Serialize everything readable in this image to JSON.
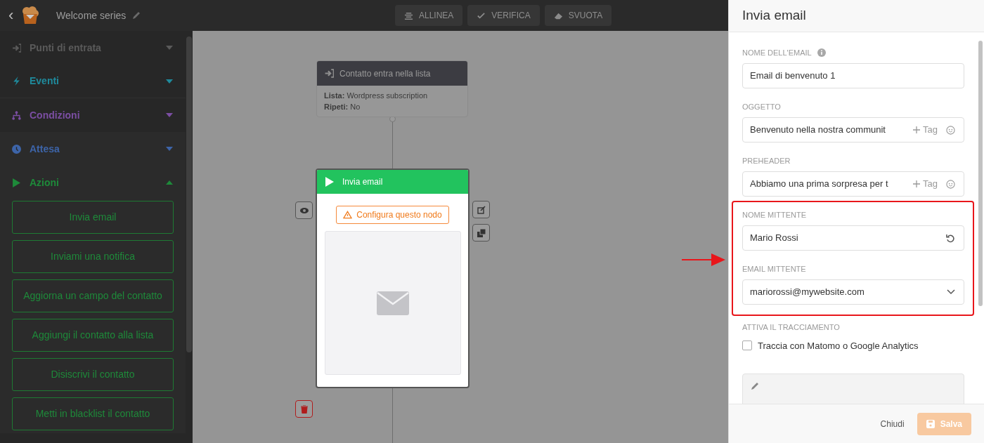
{
  "header": {
    "back": "‹",
    "title": "Welcome series"
  },
  "toolbar": [
    {
      "label": "ALLINEA"
    },
    {
      "label": "VERIFICA"
    },
    {
      "label": "SVUOTA"
    }
  ],
  "sidebar": {
    "sections": [
      {
        "label": "Punti di entrata",
        "color": "#5a5a5a",
        "expanded": false
      },
      {
        "label": "Eventi",
        "color": "#1f8a9c",
        "expanded": false
      },
      {
        "label": "Condizioni",
        "color": "#7b4ea3",
        "expanded": false
      },
      {
        "label": "Attesa",
        "color": "#3d64a8",
        "expanded": false
      },
      {
        "label": "Azioni",
        "color": "#1e8a3a",
        "expanded": true,
        "items": [
          "Invia email",
          "Inviami una notifica",
          "Aggiorna un campo del contatto",
          "Aggiungi il contatto alla lista",
          "Disiscrivi il contatto",
          "Metti in blacklist il contatto"
        ]
      }
    ]
  },
  "canvas": {
    "trigger": {
      "title": "Contatto entra nella lista",
      "lines": [
        {
          "key": "Lista:",
          "value": "Wordpress subscription"
        },
        {
          "key": "Ripeti:",
          "value": "No"
        }
      ]
    },
    "action": {
      "title": "Invia email",
      "warning": "Configura questo nodo"
    }
  },
  "panel": {
    "title": "Invia email",
    "fields": [
      {
        "kind": "text",
        "label": "NOME DELL'EMAIL",
        "info": true,
        "value": "Email di benvenuto 1"
      },
      {
        "kind": "tag",
        "label": "OGGETTO",
        "info": false,
        "value": "Benvenuto nella nostra communit",
        "tag": "Tag"
      },
      {
        "kind": "tag",
        "label": "PREHEADER",
        "info": false,
        "value": "Abbiamo una prima sorpresa per t",
        "tag": "Tag"
      },
      {
        "kind": "reset",
        "label": "NOME MITTENTE",
        "info": false,
        "value": "Mario Rossi"
      },
      {
        "kind": "select",
        "label": "EMAIL MITTENTE",
        "info": false,
        "value": "mariorossi@mywebsite.com"
      }
    ],
    "tracking": {
      "label": "ATTIVA IL TRACCIAMENTO",
      "option": "Traccia con Matomo o Google Analytics",
      "checked": false
    },
    "footer": {
      "cancel": "Chiudi",
      "save": {
        "label": "Salva",
        "disabled": true
      }
    }
  }
}
